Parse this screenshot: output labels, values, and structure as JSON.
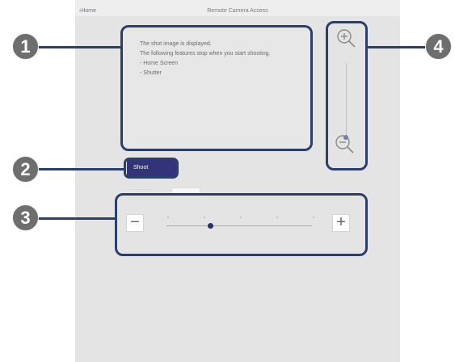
{
  "topbar": {
    "back_label": "‹Home",
    "title": "Remote Camera Access"
  },
  "preview": {
    "lines": [
      "The shot image is displayed.",
      "The following features stop when you start shooting.",
      "- Home Screen",
      "- Shutter"
    ]
  },
  "shoot_button": {
    "label": "Shoot"
  },
  "brightness": {
    "minus_label": "−",
    "plus_label": "+",
    "level": 0.3
  },
  "zoom": {
    "level": 0.0
  },
  "callouts": [
    "1",
    "2",
    "3",
    "4"
  ],
  "colors": {
    "accent": "#2b3f6a",
    "shoot_button": "#33337a",
    "callout": "#6e6e6e"
  }
}
